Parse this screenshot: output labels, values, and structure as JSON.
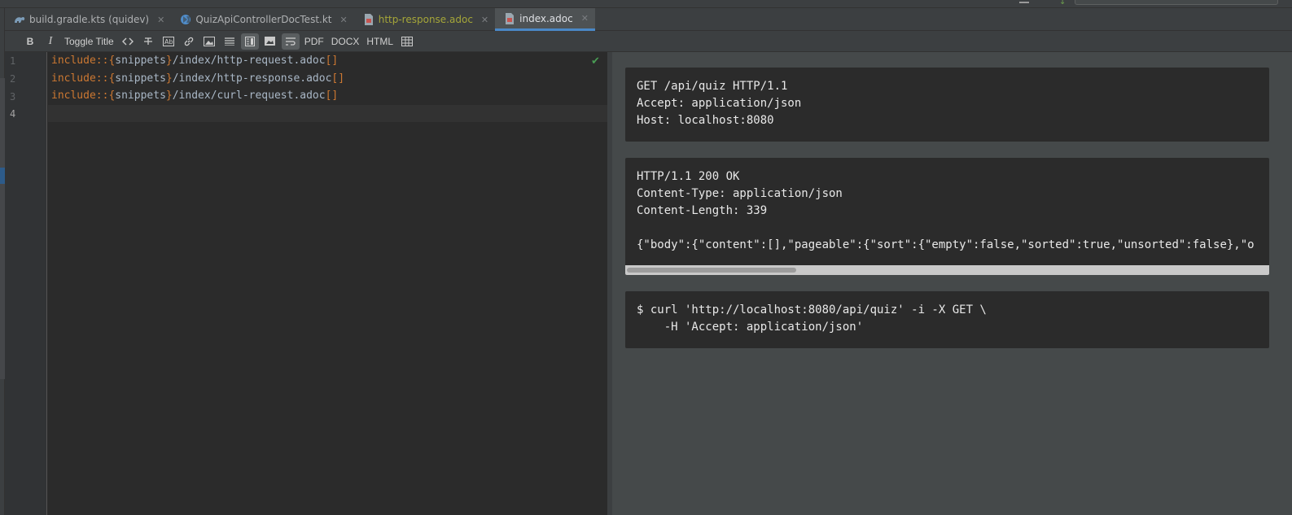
{
  "tabs": [
    {
      "label": "build.gradle.kts (quidev)",
      "icon": "gradle-icon",
      "state": "normal"
    },
    {
      "label": "QuizApiControllerDocTest.kt",
      "icon": "kotlin-class-icon",
      "state": "normal"
    },
    {
      "label": "http-response.adoc",
      "icon": "asciidoc-file-icon",
      "state": "modified"
    },
    {
      "label": "index.adoc",
      "icon": "asciidoc-file-icon",
      "state": "active"
    }
  ],
  "toolbar": {
    "bold": "B",
    "italic": "I",
    "toggle_title": "Toggle Title",
    "pdf": "PDF",
    "docx": "DOCX",
    "html": "HTML"
  },
  "editor": {
    "line_numbers": [
      "1",
      "2",
      "3",
      "4"
    ],
    "lines": [
      {
        "prefix": "include::{",
        "attr": "snippets",
        "close": "}",
        "path": "/index/http-request.adoc",
        "brackets": "[]"
      },
      {
        "prefix": "include::{",
        "attr": "snippets",
        "close": "}",
        "path": "/index/http-response.adoc",
        "brackets": "[]"
      },
      {
        "prefix": "include::{",
        "attr": "snippets",
        "close": "}",
        "path": "/index/curl-request.adoc",
        "brackets": "[]"
      }
    ]
  },
  "preview": {
    "request": "GET /api/quiz HTTP/1.1\nAccept: application/json\nHost: localhost:8080",
    "response": "HTTP/1.1 200 OK\nContent-Type: application/json\nContent-Length: 339\n\n{\"body\":{\"content\":[],\"pageable\":{\"sort\":{\"empty\":false,\"sorted\":true,\"unsorted\":false},\"o",
    "curl": "$ curl 'http://localhost:8080/api/quiz' -i -X GET \\\n    -H 'Accept: application/json'"
  },
  "colors": {
    "keyword": "#cc7832",
    "accent": "#4a88c7",
    "modified_tab": "#a5a639",
    "check": "#499c54"
  }
}
